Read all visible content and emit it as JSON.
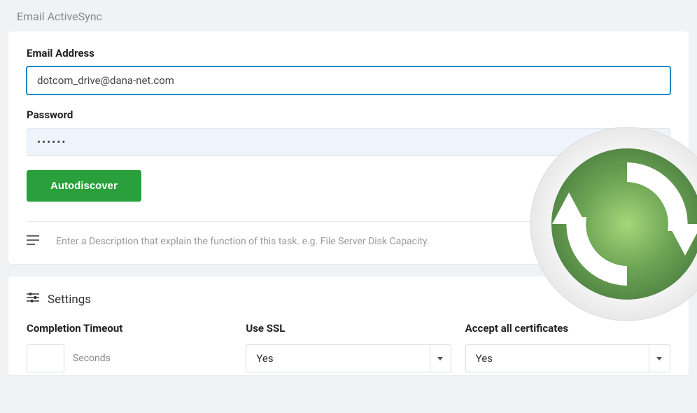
{
  "page": {
    "title": "Email ActiveSync"
  },
  "form": {
    "email_label": "Email Address",
    "email_value": "dotcom_drive@dana-net.com",
    "password_label": "Password",
    "password_value": "••••••",
    "autodiscover_label": "Autodiscover",
    "description_placeholder": "Enter a Description that explain the function of this task. e.g. File Server Disk Capacity."
  },
  "settings": {
    "header": "Settings",
    "completion_timeout_label": "Completion Timeout",
    "timeout_value": "",
    "timeout_unit": "Seconds",
    "use_ssl_label": "Use SSL",
    "use_ssl_value": "Yes",
    "accept_certs_label": "Accept all certificates",
    "accept_certs_value": "Yes"
  }
}
